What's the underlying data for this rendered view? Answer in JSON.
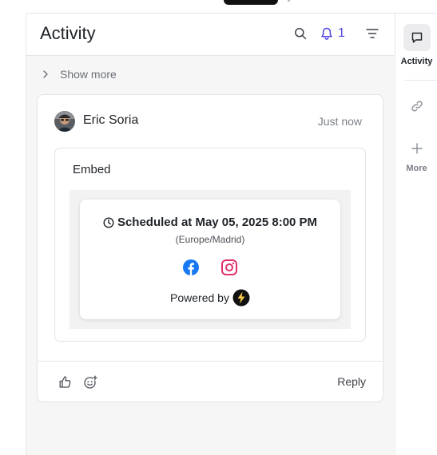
{
  "header": {
    "title": "Activity",
    "notification_count": "1"
  },
  "feed": {
    "show_more_label": "Show more",
    "item": {
      "author": "Eric Soria",
      "time": "Just now",
      "embed": {
        "label": "Embed",
        "scheduled_text": "Scheduled at May 05, 2025 8:00 PM",
        "timezone": "(Europe/Madrid)",
        "powered_by": "Powered by",
        "networks": [
          "facebook-icon",
          "instagram-icon"
        ]
      },
      "actions": {
        "reply_label": "Reply"
      }
    }
  },
  "rail": {
    "activity_label": "Activity",
    "more_label": "More"
  },
  "colors": {
    "accent": "#4f46e5",
    "facebook": "#1877f2",
    "instagram": "#e1306c"
  }
}
